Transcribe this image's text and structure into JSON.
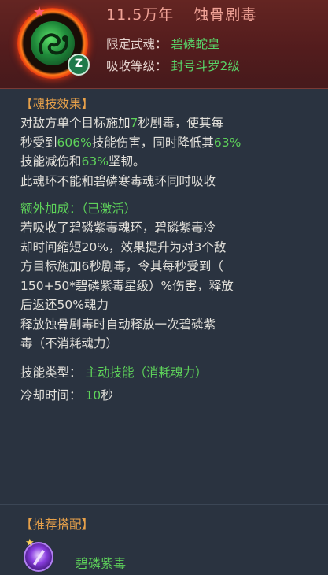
{
  "header": {
    "years": "11.5万年",
    "name": "蚀骨剧毒",
    "badge": "Z",
    "limit_label": "限定武魂：",
    "limit_value": "碧磷蛇皇",
    "level_label": "吸收等级：",
    "level_value": "封号斗罗2级"
  },
  "effect": {
    "title": "【魂技效果】",
    "l1a": "对敌方单个目标施加",
    "l1b": "7",
    "l1c": "秒剧毒，使其每",
    "l2a": "秒受到",
    "l2b": "606%",
    "l2c": "技能伤害，同时降低其",
    "l2d": "63%",
    "l3a": "技能减伤和",
    "l3b": "63%",
    "l3c": "坚韧。",
    "l4": "此魂环不能和碧磷寒毒魂环同时吸收"
  },
  "extra": {
    "title": "额外加成：（已激活）",
    "lines": [
      "若吸收了碧磷紫毒魂环，碧磷紫毒冷",
      "却时间缩短20%，效果提升为对3个敌",
      "方目标施加6秒剧毒，令其每秒受到（",
      "150+50*碧磷紫毒星级）%伤害，释放",
      "后返还50%魂力",
      "释放蚀骨剧毒时自动释放一次碧磷紫",
      "毒（不消耗魂力）"
    ]
  },
  "meta": {
    "type_label": "技能类型：",
    "type_value": "主动技能（消耗魂力）",
    "cd_label": "冷却时间：",
    "cd_num": "10",
    "cd_unit": "秒"
  },
  "recommend": {
    "title": "【推荐搭配】",
    "item_name": "碧磷紫毒"
  },
  "icons": {
    "main": "snake-soul-ring-icon",
    "star": "star-icon",
    "rec": "purple-poison-icon"
  },
  "colors": {
    "green": "#5ed35a",
    "orange": "#e9a24a",
    "header_bg": "#531c1d"
  }
}
